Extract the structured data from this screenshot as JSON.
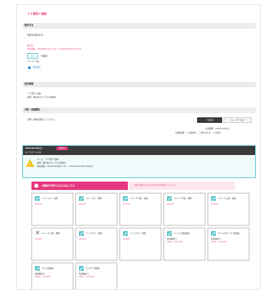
{
  "brand": "ＦＣ東京ｘ協約",
  "sections": {
    "sales_info": "販売方法",
    "game_info": "試合情報",
    "date_select": "日程・席種選択"
  },
  "sales": {
    "method": "選択中の販売方法",
    "period_label": "販売中",
    "period": "受付期間：2016年8/9(火)11:00 ～ 2016年10/25(木)23:59",
    "tag": "先着",
    "tag_note": "一般販売",
    "limit": "ＦＣ０１０先",
    "seat_link": "座席確認"
  },
  "game": {
    "line1": "ＦＣ東京ｘ協約",
    "line2": "会場：味の素スタジアム[協会席]"
  },
  "select": {
    "prompt": "日程・席種を選択してください。",
    "list_btn": "一覧表示",
    "calendar_btn": "カレンダー表示",
    "date_note": "公演期間：2016/10/29(土)",
    "legend": "[記載情報]　○ 先着あり　△ 残りわずか　× 売切れ"
  },
  "event": {
    "date": "2016/10/29(土)",
    "badge": "発売中",
    "time": "キックオフ 14:00",
    "l1": "ホーム：ＦＣ東京ｘ協約",
    "l2": "会場：味の素スタジアム[協会席]",
    "l3": "受付期間：2016/9/30(金)11:00 ～ 2016/10/25(木)23:59まで"
  },
  "cta": {
    "label": "公開席がお待ちされるかはこちら",
    "note": "お席を選択されたお日付でお席を選択してください。"
  },
  "cards": [
    {
      "name": "メインスラ　北側",
      "price": "¥6,100",
      "icon": "circle"
    },
    {
      "name": "メインスラ　南側",
      "price": "¥6,100",
      "icon": "circle"
    },
    {
      "name": "メインＳ下層　北側",
      "price": "¥4,700",
      "icon": "circle"
    },
    {
      "name": "メインＳ下層　南側",
      "price": "¥4,700",
      "icon": "circle"
    },
    {
      "name": "メインＳ上層　北側",
      "price": "¥5,200",
      "icon": "circle"
    },
    {
      "name": "メインＡ上層　南側",
      "price": "¥5,200",
      "icon": "cross"
    },
    {
      "name": "バックＳＡ　北側",
      "price": "¥5,200",
      "icon": "circle"
    },
    {
      "name": "バックＳＡ　南側",
      "price": "¥4,600",
      "icon": "circle"
    },
    {
      "name": "バック上層自由席",
      "sub": "各席種あり",
      "price": "¥400 ～ ¥2,300",
      "icon": "circle"
    },
    {
      "name": "ホームサポーター自由席",
      "sub": "各席種あり",
      "price": "¥400 ～ ¥2,300",
      "icon": "circle"
    },
    {
      "name": "ホーム自由席",
      "sub": "各席種あり",
      "price": "¥400 ～ ¥2,300",
      "icon": "circle"
    },
    {
      "name": "ビジター自由席",
      "sub": "各席種あり",
      "price": "¥400 ～ ¥2,300",
      "icon": "circle"
    }
  ]
}
